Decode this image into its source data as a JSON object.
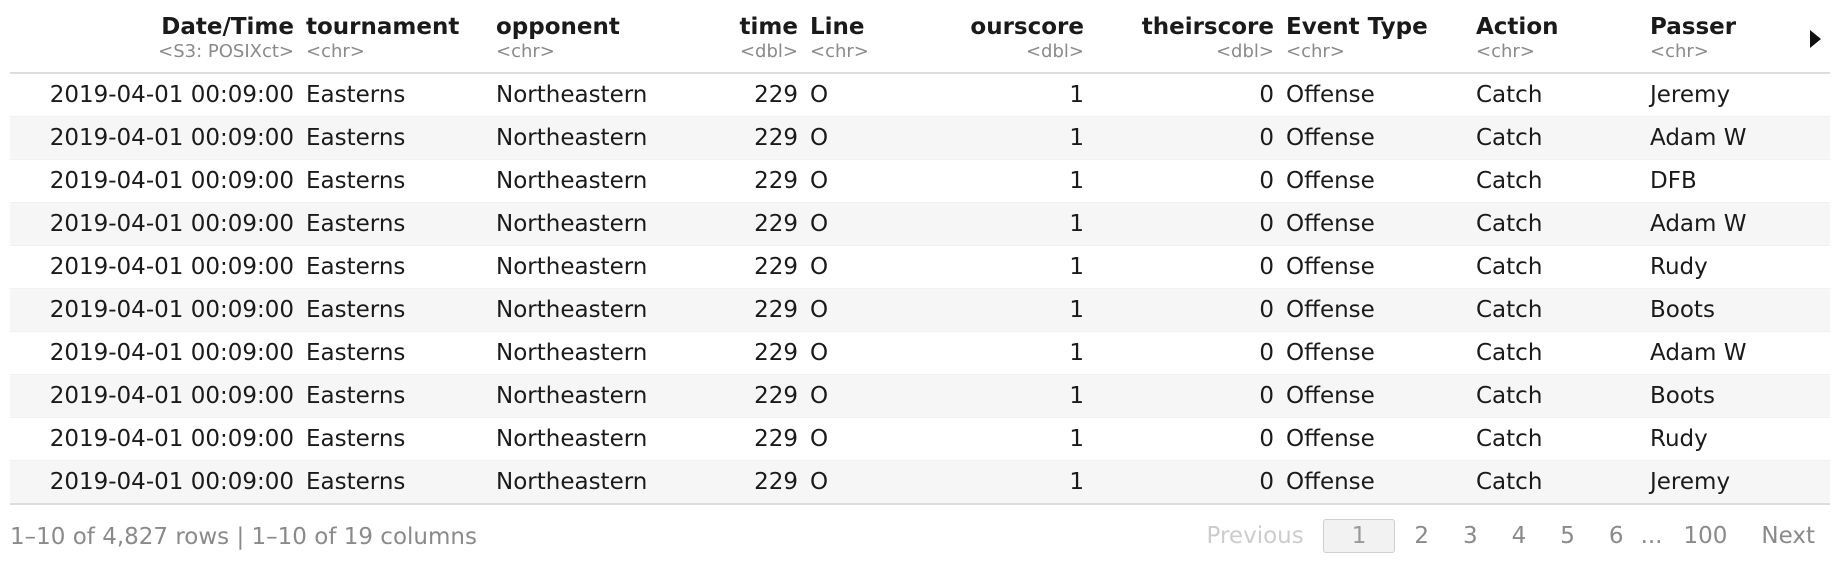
{
  "columns": [
    {
      "name": "Date/Time",
      "type": "<S3: POSIXct>",
      "align": "right"
    },
    {
      "name": "tournament",
      "type": "<chr>",
      "align": "left"
    },
    {
      "name": "opponent",
      "type": "<chr>",
      "align": "left"
    },
    {
      "name": "time",
      "type": "<dbl>",
      "align": "right"
    },
    {
      "name": "Line",
      "type": "<chr>",
      "align": "left"
    },
    {
      "name": "ourscore",
      "type": "<dbl>",
      "align": "right"
    },
    {
      "name": "theirscore",
      "type": "<dbl>",
      "align": "right"
    },
    {
      "name": "Event Type",
      "type": "<chr>",
      "align": "left"
    },
    {
      "name": "Action",
      "type": "<chr>",
      "align": "left"
    },
    {
      "name": "Passer",
      "type": "<chr>",
      "align": "left"
    }
  ],
  "rows": [
    [
      "2019-04-01 00:09:00",
      "Easterns",
      "Northeastern",
      "229",
      "O",
      "1",
      "0",
      "Offense",
      "Catch",
      "Jeremy"
    ],
    [
      "2019-04-01 00:09:00",
      "Easterns",
      "Northeastern",
      "229",
      "O",
      "1",
      "0",
      "Offense",
      "Catch",
      "Adam W"
    ],
    [
      "2019-04-01 00:09:00",
      "Easterns",
      "Northeastern",
      "229",
      "O",
      "1",
      "0",
      "Offense",
      "Catch",
      "DFB"
    ],
    [
      "2019-04-01 00:09:00",
      "Easterns",
      "Northeastern",
      "229",
      "O",
      "1",
      "0",
      "Offense",
      "Catch",
      "Adam W"
    ],
    [
      "2019-04-01 00:09:00",
      "Easterns",
      "Northeastern",
      "229",
      "O",
      "1",
      "0",
      "Offense",
      "Catch",
      "Rudy"
    ],
    [
      "2019-04-01 00:09:00",
      "Easterns",
      "Northeastern",
      "229",
      "O",
      "1",
      "0",
      "Offense",
      "Catch",
      "Boots"
    ],
    [
      "2019-04-01 00:09:00",
      "Easterns",
      "Northeastern",
      "229",
      "O",
      "1",
      "0",
      "Offense",
      "Catch",
      "Adam W"
    ],
    [
      "2019-04-01 00:09:00",
      "Easterns",
      "Northeastern",
      "229",
      "O",
      "1",
      "0",
      "Offense",
      "Catch",
      "Boots"
    ],
    [
      "2019-04-01 00:09:00",
      "Easterns",
      "Northeastern",
      "229",
      "O",
      "1",
      "0",
      "Offense",
      "Catch",
      "Rudy"
    ],
    [
      "2019-04-01 00:09:00",
      "Easterns",
      "Northeastern",
      "229",
      "O",
      "1",
      "0",
      "Offense",
      "Catch",
      "Jeremy"
    ]
  ],
  "next_columns_icon": "triangle-right-icon",
  "footer": {
    "info": "1–10 of 4,827 rows | 1–10 of 19 columns",
    "pagination": {
      "previous_label": "Previous",
      "pages": [
        "1",
        "2",
        "3",
        "4",
        "5",
        "6"
      ],
      "current_page": "1",
      "ellipsis": "...",
      "last_page": "100",
      "next_label": "Next"
    }
  },
  "colors": {
    "header_border": "#dcdcdc",
    "stripe": "#f6f6f6",
    "muted_text": "#8a8a8a",
    "disabled_text": "#cccccc"
  }
}
